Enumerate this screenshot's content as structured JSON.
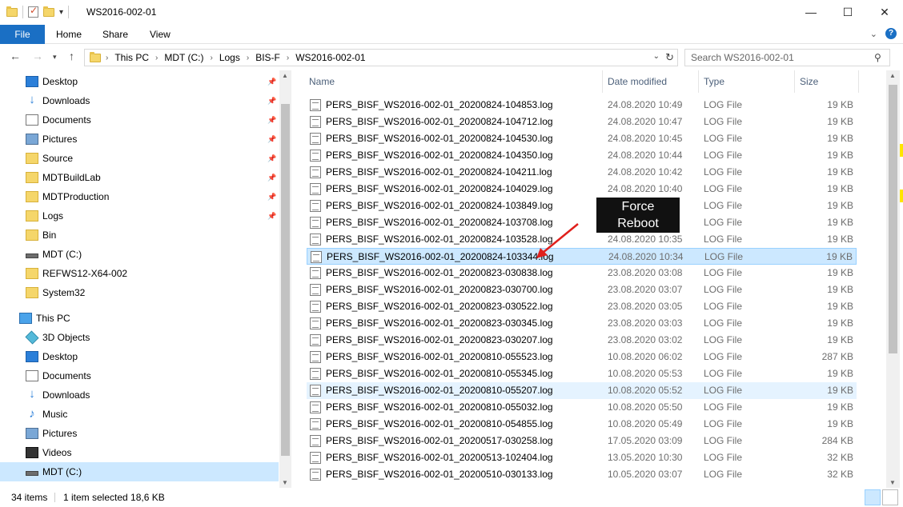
{
  "window": {
    "title": "WS2016-002-01",
    "controls": [
      "—",
      "☐",
      "✕"
    ]
  },
  "ribbon": {
    "tabs": [
      "File",
      "Home",
      "Share",
      "View"
    ],
    "expand": "⌄",
    "help": "?"
  },
  "address": {
    "crumbs": [
      "This PC",
      "MDT (C:)",
      "Logs",
      "BIS-F",
      "WS2016-002-01"
    ],
    "search_placeholder": "Search WS2016-002-01"
  },
  "navigation": {
    "quick_access": [
      {
        "label": "Desktop",
        "icon": "desktop-icon",
        "pinned": true
      },
      {
        "label": "Downloads",
        "icon": "downloads-icon",
        "pinned": true
      },
      {
        "label": "Documents",
        "icon": "documents-icon",
        "pinned": true
      },
      {
        "label": "Pictures",
        "icon": "pictures-icon",
        "pinned": true
      },
      {
        "label": "Source",
        "icon": "folder-icon",
        "pinned": true
      },
      {
        "label": "MDTBuildLab",
        "icon": "folder-icon",
        "pinned": true
      },
      {
        "label": "MDTProduction",
        "icon": "folder-icon",
        "pinned": true
      },
      {
        "label": "Logs",
        "icon": "folder-icon",
        "pinned": true
      },
      {
        "label": "Bin",
        "icon": "folder-icon",
        "pinned": false
      },
      {
        "label": "MDT (C:)",
        "icon": "drive-icon",
        "pinned": false
      },
      {
        "label": "REFWS12-X64-002",
        "icon": "folder-icon",
        "pinned": false
      },
      {
        "label": "System32",
        "icon": "folder-icon",
        "pinned": false
      }
    ],
    "this_pc_label": "This PC",
    "this_pc": [
      {
        "label": "3D Objects",
        "icon": "3d-objects-icon"
      },
      {
        "label": "Desktop",
        "icon": "desktop-icon"
      },
      {
        "label": "Documents",
        "icon": "documents-icon"
      },
      {
        "label": "Downloads",
        "icon": "downloads-icon"
      },
      {
        "label": "Music",
        "icon": "music-icon"
      },
      {
        "label": "Pictures",
        "icon": "pictures-icon"
      },
      {
        "label": "Videos",
        "icon": "videos-icon"
      },
      {
        "label": "MDT (C:)",
        "icon": "drive-icon",
        "selected": true
      }
    ]
  },
  "columns": {
    "name": "Name",
    "date": "Date modified",
    "type": "Type",
    "size": "Size"
  },
  "files": [
    {
      "name": "PERS_BISF_WS2016-002-01_20200824-104853.log",
      "date": "24.08.2020 10:49",
      "type": "LOG File",
      "size": "19 KB"
    },
    {
      "name": "PERS_BISF_WS2016-002-01_20200824-104712.log",
      "date": "24.08.2020 10:47",
      "type": "LOG File",
      "size": "19 KB"
    },
    {
      "name": "PERS_BISF_WS2016-002-01_20200824-104530.log",
      "date": "24.08.2020 10:45",
      "type": "LOG File",
      "size": "19 KB"
    },
    {
      "name": "PERS_BISF_WS2016-002-01_20200824-104350.log",
      "date": "24.08.2020 10:44",
      "type": "LOG File",
      "size": "19 KB"
    },
    {
      "name": "PERS_BISF_WS2016-002-01_20200824-104211.log",
      "date": "24.08.2020 10:42",
      "type": "LOG File",
      "size": "19 KB"
    },
    {
      "name": "PERS_BISF_WS2016-002-01_20200824-104029.log",
      "date": "24.08.2020 10:40",
      "type": "LOG File",
      "size": "19 KB"
    },
    {
      "name": "PERS_BISF_WS2016-002-01_20200824-103849.log",
      "date": "",
      "type": "LOG File",
      "size": "19 KB"
    },
    {
      "name": "PERS_BISF_WS2016-002-01_20200824-103708.log",
      "date": "",
      "type": "LOG File",
      "size": "19 KB"
    },
    {
      "name": "PERS_BISF_WS2016-002-01_20200824-103528.log",
      "date": "24.08.2020 10:35",
      "type": "LOG File",
      "size": "19 KB"
    },
    {
      "name": "PERS_BISF_WS2016-002-01_20200824-103344.log",
      "date": "24.08.2020 10:34",
      "type": "LOG File",
      "size": "19 KB",
      "state": "sel"
    },
    {
      "name": "PERS_BISF_WS2016-002-01_20200823-030838.log",
      "date": "23.08.2020 03:08",
      "type": "LOG File",
      "size": "19 KB"
    },
    {
      "name": "PERS_BISF_WS2016-002-01_20200823-030700.log",
      "date": "23.08.2020 03:07",
      "type": "LOG File",
      "size": "19 KB"
    },
    {
      "name": "PERS_BISF_WS2016-002-01_20200823-030522.log",
      "date": "23.08.2020 03:05",
      "type": "LOG File",
      "size": "19 KB"
    },
    {
      "name": "PERS_BISF_WS2016-002-01_20200823-030345.log",
      "date": "23.08.2020 03:03",
      "type": "LOG File",
      "size": "19 KB"
    },
    {
      "name": "PERS_BISF_WS2016-002-01_20200823-030207.log",
      "date": "23.08.2020 03:02",
      "type": "LOG File",
      "size": "19 KB"
    },
    {
      "name": "PERS_BISF_WS2016-002-01_20200810-055523.log",
      "date": "10.08.2020 06:02",
      "type": "LOG File",
      "size": "287 KB"
    },
    {
      "name": "PERS_BISF_WS2016-002-01_20200810-055345.log",
      "date": "10.08.2020 05:53",
      "type": "LOG File",
      "size": "19 KB"
    },
    {
      "name": "PERS_BISF_WS2016-002-01_20200810-055207.log",
      "date": "10.08.2020 05:52",
      "type": "LOG File",
      "size": "19 KB",
      "state": "hover"
    },
    {
      "name": "PERS_BISF_WS2016-002-01_20200810-055032.log",
      "date": "10.08.2020 05:50",
      "type": "LOG File",
      "size": "19 KB"
    },
    {
      "name": "PERS_BISF_WS2016-002-01_20200810-054855.log",
      "date": "10.08.2020 05:49",
      "type": "LOG File",
      "size": "19 KB"
    },
    {
      "name": "PERS_BISF_WS2016-002-01_20200517-030258.log",
      "date": "17.05.2020 03:09",
      "type": "LOG File",
      "size": "284 KB"
    },
    {
      "name": "PERS_BISF_WS2016-002-01_20200513-102404.log",
      "date": "13.05.2020 10:30",
      "type": "LOG File",
      "size": "32 KB"
    },
    {
      "name": "PERS_BISF_WS2016-002-01_20200510-030133.log",
      "date": "10.05.2020 03:07",
      "type": "LOG File",
      "size": "32 KB"
    }
  ],
  "annotation": {
    "line1": "Force",
    "line2": "Reboot",
    "color": "#e0201c"
  },
  "status": {
    "items": "34 items",
    "selected": "1 item selected  18,6 KB"
  },
  "colors": {
    "accent": "#1a6fc4",
    "selection": "#cce8ff"
  }
}
